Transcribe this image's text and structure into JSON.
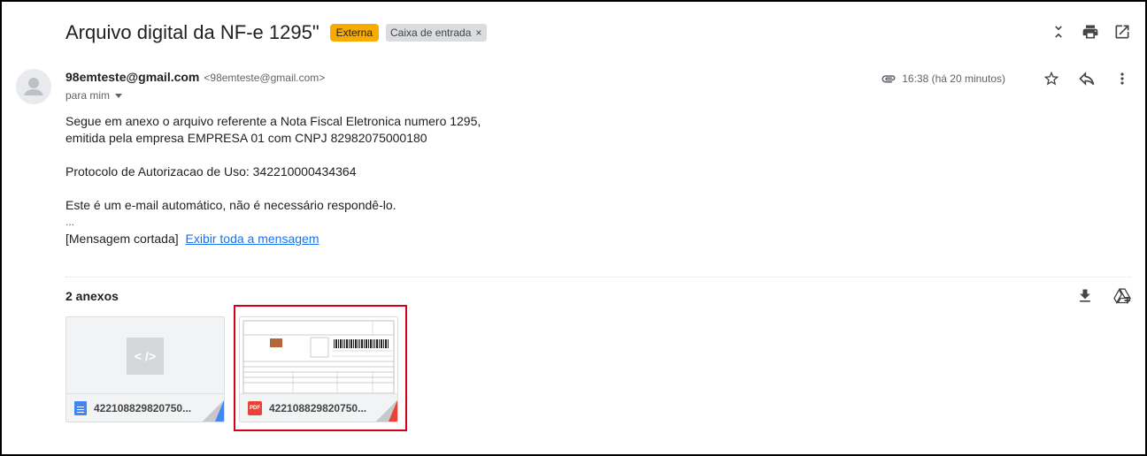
{
  "header": {
    "subject": "Arquivo digital da NF-e 1295\"",
    "badge_external": "Externa",
    "label": "Caixa de entrada",
    "label_remove": "×"
  },
  "sender": {
    "name": "98emteste@gmail.com",
    "email": "<98emteste@gmail.com>",
    "to": "para mim"
  },
  "meta": {
    "time": "16:38 (há 20 minutos)"
  },
  "body": {
    "line1": "Segue em anexo o arquivo referente a Nota Fiscal Eletronica numero 1295,",
    "line2": "emitida pela empresa EMPRESA 01 com CNPJ 82982075000180",
    "line3": "Protocolo de Autorizacao de Uso: 342210000434364",
    "line4": "Este é um e-mail automático, não é necessário respondê-lo.",
    "ellipsis": "...",
    "truncated": "[Mensagem cortada]",
    "view_full": "Exibir toda a mensagem"
  },
  "attachments": {
    "title": "2 anexos",
    "items": [
      {
        "name": "422108829820750...",
        "type": "xml",
        "preview_glyph": "< />"
      },
      {
        "name": "422108829820750...",
        "type": "pdf",
        "icon_label": "PDF"
      }
    ]
  },
  "colors": {
    "badge_external": "#f9ab00",
    "label_bg": "#dadce0",
    "link": "#1a73e8",
    "highlight": "#d0021b",
    "doc_blue": "#4285f4",
    "pdf_red": "#ea4335"
  },
  "icons": {
    "toolbar": [
      "collapse-icon",
      "print-icon",
      "open-new-window-icon"
    ],
    "message": [
      "paperclip-icon",
      "star-icon",
      "reply-icon",
      "more-vert-icon"
    ],
    "attachments": [
      "download-icon",
      "add-to-drive-icon"
    ]
  }
}
